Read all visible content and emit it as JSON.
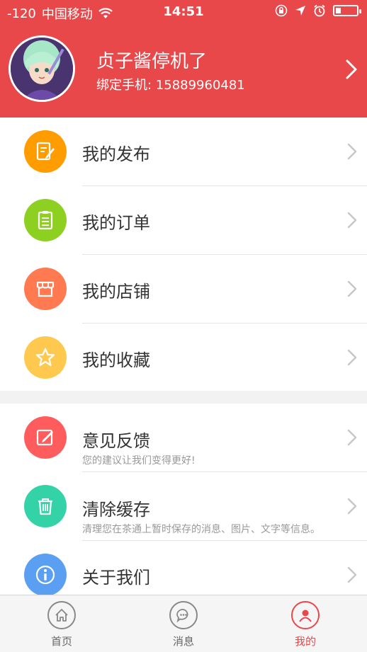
{
  "status_bar": {
    "signal": "-120",
    "carrier": "中国移动",
    "time": "14:51",
    "battery_fraction": 0.25
  },
  "profile": {
    "name": "贞子酱停机了",
    "phone": "绑定手机: 15889960481"
  },
  "menu_group_1": [
    {
      "label": "我的发布",
      "icon": "edit-document-icon",
      "color": "#ff9c00"
    },
    {
      "label": "我的订单",
      "icon": "clipboard-icon",
      "color": "#8ed021"
    },
    {
      "label": "我的店铺",
      "icon": "store-icon",
      "color": "#ff7a50"
    },
    {
      "label": "我的收藏",
      "icon": "star-icon",
      "color": "#ffc94f"
    }
  ],
  "menu_group_2": [
    {
      "label": "意见反馈",
      "subtitle": "您的建议让我们变得更好!",
      "icon": "feedback-icon",
      "color": "#ff5d5d"
    },
    {
      "label": "清除缓存",
      "subtitle": "清理您在茶通上暂时保存的消息、图片、文字等信息。",
      "icon": "trash-icon",
      "color": "#33d3a7"
    },
    {
      "label": "关于我们",
      "icon": "info-icon",
      "color": "#5a9ff2"
    }
  ],
  "tab_bar": [
    {
      "label": "首页",
      "icon": "home-icon"
    },
    {
      "label": "消息",
      "icon": "message-icon"
    },
    {
      "label": "我的",
      "icon": "person-icon",
      "active": true
    }
  ],
  "colors": {
    "accent": "#e8484a"
  }
}
